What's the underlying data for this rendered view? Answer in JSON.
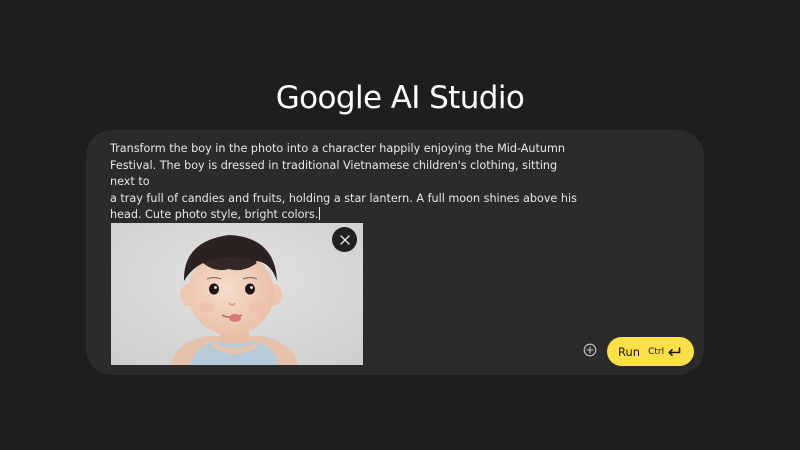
{
  "header": {
    "title": "Google AI Studio"
  },
  "prompt": {
    "lines": [
      "Transform the boy in the photo into a character happily enjoying the Mid-Autumn",
      "Festival. The boy is dressed in traditional Vietnamese children's clothing, sitting next to",
      "a tray full of candies and fruits, holding a star lantern. A full moon shines above his",
      "head. Cute photo style, bright colors."
    ]
  },
  "attachment": {
    "remove_icon": "close-icon"
  },
  "actions": {
    "add_icon": "add-circle-icon",
    "run_label": "Run",
    "run_shortcut": "Ctrl",
    "run_shortcut_icon": "enter-key-icon"
  },
  "colors": {
    "background": "#1e1e1f",
    "card": "#2b2b2c",
    "run_button": "#fde047",
    "remove_button": "#202021"
  }
}
